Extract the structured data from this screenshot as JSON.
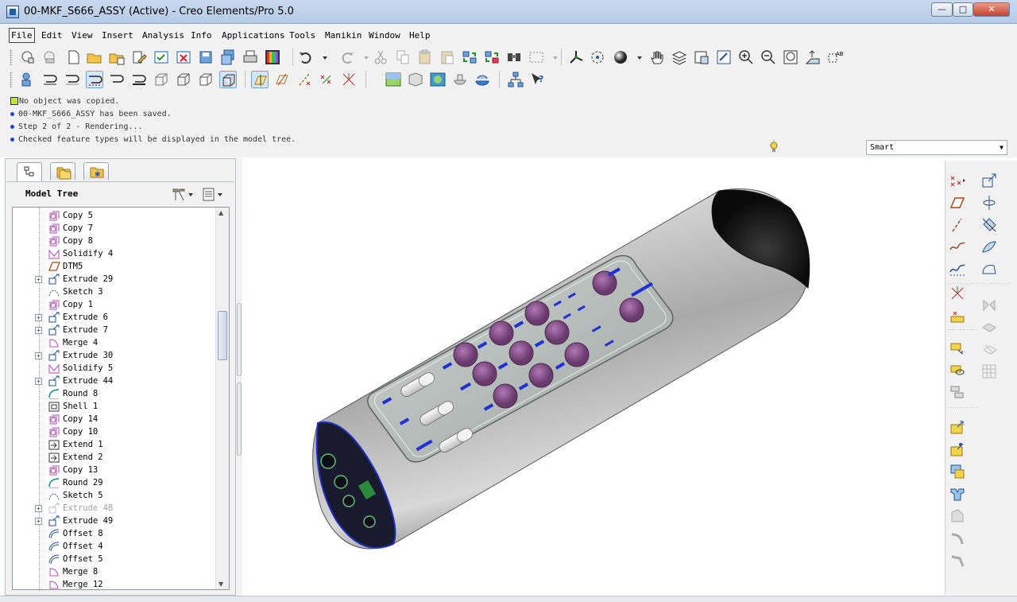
{
  "window": {
    "title": "00-MKF_S666_ASSY (Active) - Creo Elements/Pro 5.0",
    "minimize_glyph": "—",
    "maximize_glyph": "□",
    "close_glyph": "✕"
  },
  "menu": [
    {
      "label": "File",
      "key": "F"
    },
    {
      "label": "Edit",
      "key": "E"
    },
    {
      "label": "View",
      "key": "V"
    },
    {
      "label": "Insert",
      "key": "I"
    },
    {
      "label": "Analysis",
      "key": "A"
    },
    {
      "label": "Info",
      "key": "I"
    },
    {
      "label": "Applications",
      "key": "A"
    },
    {
      "label": "Tools",
      "key": "T"
    },
    {
      "label": "Manikin",
      "key": "M"
    },
    {
      "label": "Window",
      "key": "W"
    },
    {
      "label": "Help",
      "key": "H"
    }
  ],
  "toolbar_icons": {
    "row1": [
      "new-icon",
      "open-icon",
      "save-icon",
      "print-icon",
      "undo-icon",
      "redo-icon",
      "cut-icon",
      "copy-icon",
      "paste-icon",
      "regenerate-icon",
      "find-icon",
      "zoom-in-icon",
      "zoom-out-icon",
      "refit-icon",
      "spin-center-icon"
    ],
    "row2": [
      "datum-display-icon",
      "wireframe-icon",
      "hidden-line-icon",
      "shaded-icon",
      "datum-plane-icon",
      "datum-axis-icon",
      "datum-point-icon",
      "csys-icon",
      "render-icon",
      "help-icon"
    ]
  },
  "messages": [
    {
      "type": "warning",
      "text": "No object was copied."
    },
    {
      "type": "info",
      "text": "00-MKF_S666_ASSY has been saved."
    },
    {
      "type": "info",
      "text": "Step 2 of 2 - Rendering..."
    },
    {
      "type": "info",
      "text": "Checked feature types will be displayed in the model tree."
    }
  ],
  "filter": {
    "selected": "Smart",
    "arrow": "▼"
  },
  "model_tree": {
    "title": "Model Tree",
    "items": [
      {
        "label": "Copy 5",
        "icon": "copy-icon",
        "expandable": false,
        "suppressed": false
      },
      {
        "label": "Copy 7",
        "icon": "copy-icon",
        "expandable": false,
        "suppressed": false
      },
      {
        "label": "Copy 8",
        "icon": "copy-icon",
        "expandable": false,
        "suppressed": false
      },
      {
        "label": "Solidify 4",
        "icon": "solidify-icon",
        "expandable": false,
        "suppressed": false
      },
      {
        "label": "DTM5",
        "icon": "datum-plane-icon",
        "expandable": false,
        "suppressed": false
      },
      {
        "label": "Extrude 29",
        "icon": "extrude-icon",
        "expandable": true,
        "suppressed": false
      },
      {
        "label": "Sketch 3",
        "icon": "sketch-icon",
        "expandable": false,
        "suppressed": false
      },
      {
        "label": "Copy 1",
        "icon": "copy-icon",
        "expandable": false,
        "suppressed": false
      },
      {
        "label": "Extrude 6",
        "icon": "extrude-icon",
        "expandable": true,
        "suppressed": false
      },
      {
        "label": "Extrude 7",
        "icon": "extrude-icon",
        "expandable": true,
        "suppressed": false
      },
      {
        "label": "Merge 4",
        "icon": "merge-icon",
        "expandable": false,
        "suppressed": false
      },
      {
        "label": "Extrude 30",
        "icon": "extrude-icon",
        "expandable": true,
        "suppressed": false
      },
      {
        "label": "Solidify 5",
        "icon": "solidify-icon",
        "expandable": false,
        "suppressed": false
      },
      {
        "label": "Extrude 44",
        "icon": "extrude-icon",
        "expandable": true,
        "suppressed": false
      },
      {
        "label": "Round 8",
        "icon": "round-icon",
        "expandable": false,
        "suppressed": false
      },
      {
        "label": "Shell 1",
        "icon": "shell-icon",
        "expandable": false,
        "suppressed": false
      },
      {
        "label": "Copy 14",
        "icon": "copy-icon",
        "expandable": false,
        "suppressed": false
      },
      {
        "label": "Copy 10",
        "icon": "copy-icon",
        "expandable": false,
        "suppressed": false
      },
      {
        "label": "Extend 1",
        "icon": "extend-icon",
        "expandable": false,
        "suppressed": false
      },
      {
        "label": "Extend 2",
        "icon": "extend-icon",
        "expandable": false,
        "suppressed": false
      },
      {
        "label": "Copy 13",
        "icon": "copy-icon",
        "expandable": false,
        "suppressed": false
      },
      {
        "label": "Round 29",
        "icon": "round-icon",
        "expandable": false,
        "suppressed": false
      },
      {
        "label": "Sketch 5",
        "icon": "sketch-icon",
        "expandable": false,
        "suppressed": false
      },
      {
        "label": "Extrude 48",
        "icon": "extrude-icon",
        "expandable": true,
        "suppressed": true
      },
      {
        "label": "Extrude 49",
        "icon": "extrude-icon",
        "expandable": true,
        "suppressed": false
      },
      {
        "label": "Offset 8",
        "icon": "offset-icon",
        "expandable": false,
        "suppressed": false
      },
      {
        "label": "Offset 4",
        "icon": "offset-icon",
        "expandable": false,
        "suppressed": false
      },
      {
        "label": "Offset 5",
        "icon": "offset-icon",
        "expandable": false,
        "suppressed": false
      },
      {
        "label": "Merge 8",
        "icon": "merge-icon",
        "expandable": false,
        "suppressed": false
      },
      {
        "label": "Merge 12",
        "icon": "merge-icon",
        "expandable": false,
        "suppressed": false
      }
    ]
  },
  "colors": {
    "accent": "#1b48c8",
    "model_body": "#c8c8c8",
    "button_purple": "#8a4f8e",
    "label_blue": "#1f2fe0"
  }
}
